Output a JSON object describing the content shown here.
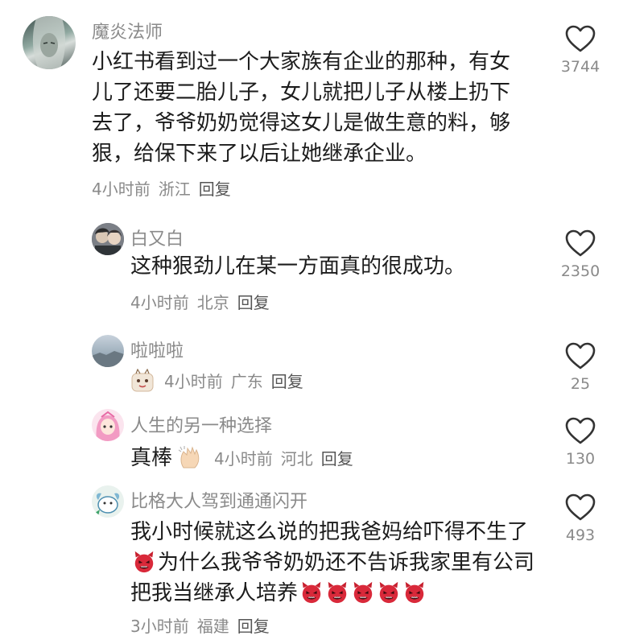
{
  "comments": [
    {
      "username": "魔炎法师",
      "text": "小红书看到过一个大家族有企业的那种，有女儿了还要二胎儿子，女儿就把儿子从楼上扔下去了，爷爷奶奶觉得这女儿是做生意的料，够狠，给保下来了以后让她继承企业。",
      "time": "4小时前",
      "location": "浙江",
      "reply": "回复",
      "likes": "3744"
    },
    {
      "username": "白又白",
      "text": "这种狠劲儿在某一方面真的很成功。",
      "time": "4小时前",
      "location": "北京",
      "reply": "回复",
      "likes": "2350"
    },
    {
      "username": "啦啦啦",
      "time": "4小时前",
      "location": "广东",
      "reply": "回复",
      "likes": "25"
    },
    {
      "username": "人生的另一种选择",
      "text": "真棒",
      "time": "4小时前",
      "location": "河北",
      "reply": "回复",
      "likes": "130"
    },
    {
      "username": "比格大人驾到通通闪开",
      "text_part1": "我小时候就这么说的把我爸妈给吓得不生了",
      "text_part2": "为什么我爷爷奶奶还不告诉我家里有公司把我当继承人培养",
      "time": "3小时前",
      "location": "福建",
      "reply": "回复",
      "likes": "493"
    }
  ]
}
